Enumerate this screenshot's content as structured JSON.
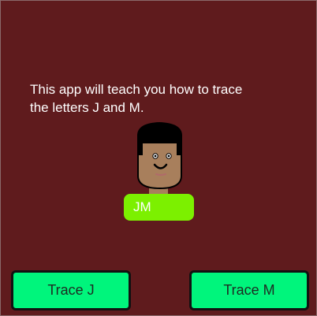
{
  "intro": {
    "text": "This app will teach you how to trace\n the letters J and M."
  },
  "avatar": {
    "icon": "boy-face-icon",
    "skin_color": "#a87f5c",
    "hair_color": "#000000"
  },
  "badge": {
    "label": "JM",
    "color": "#7cf000"
  },
  "buttons": {
    "trace_j": "Trace J",
    "trace_m": "Trace M",
    "color": "#00f57c"
  },
  "colors": {
    "background": "#5f1b1d"
  }
}
